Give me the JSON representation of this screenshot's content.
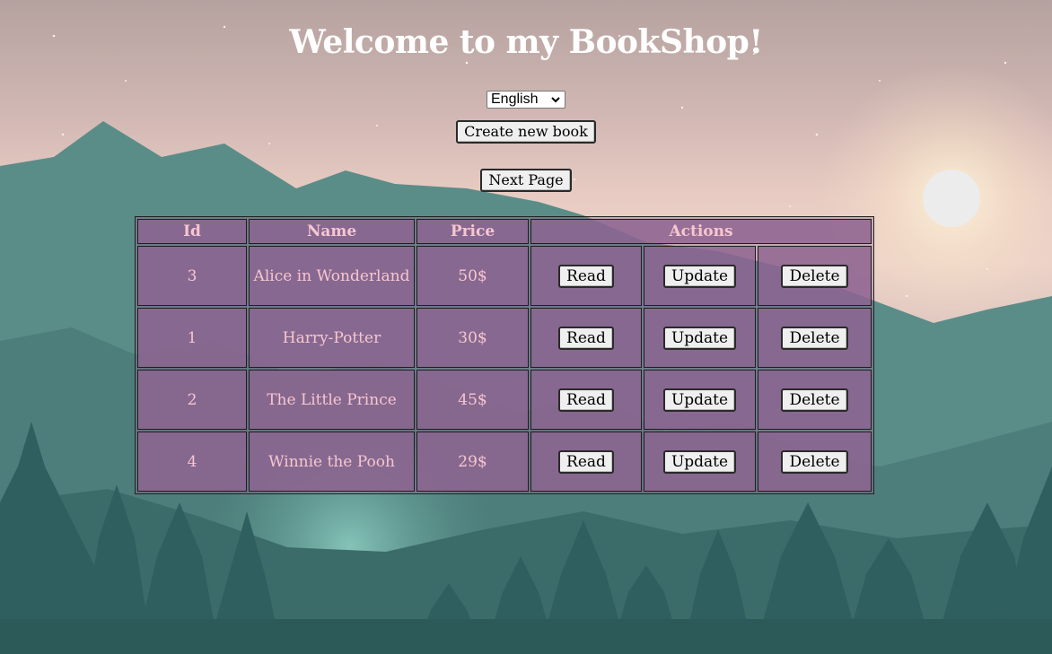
{
  "page": {
    "title": "Welcome to my BookShop!"
  },
  "language": {
    "selected": "English"
  },
  "buttons": {
    "create": "Create new book",
    "next": "Next Page"
  },
  "table": {
    "headers": [
      "Id",
      "Name",
      "Price",
      "Actions"
    ],
    "actions": [
      "Read",
      "Update",
      "Delete"
    ],
    "rows": [
      {
        "id": "3",
        "name": "Alice in Wonderland",
        "price": "50$"
      },
      {
        "id": "1",
        "name": "Harry-Potter",
        "price": "30$"
      },
      {
        "id": "2",
        "name": "The Little Prince",
        "price": "45$"
      },
      {
        "id": "4",
        "name": "Winnie the Pooh",
        "price": "29$"
      }
    ]
  },
  "colors": {
    "cell_bg": "#8e6491",
    "cell_text": "#f7c6cf",
    "mountain": "#4f827f",
    "trees": "#2f605f",
    "sun": "#ececec"
  }
}
